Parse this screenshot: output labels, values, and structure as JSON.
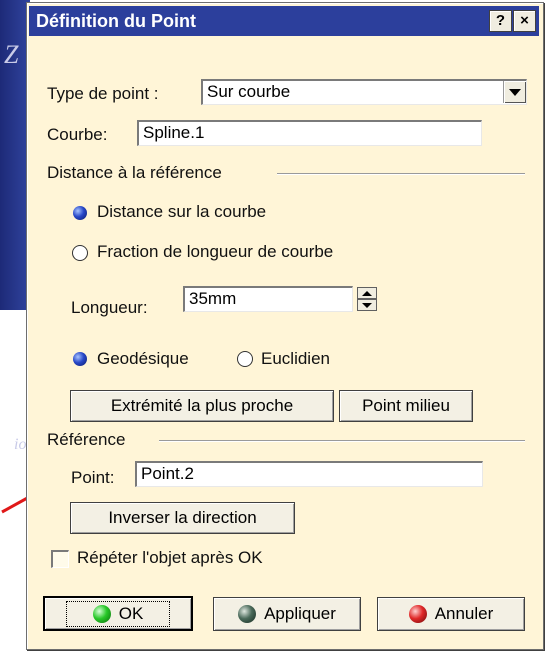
{
  "background": {
    "letter": "Z",
    "word_fragment": "io"
  },
  "dialog": {
    "title": "Définition du Point",
    "help_label": "?",
    "close_label": "×",
    "point_type": {
      "label": "Type de point :",
      "value": "Sur courbe"
    },
    "curve": {
      "label": "Courbe:",
      "value": "Spline.1"
    },
    "distance_group": {
      "label": "Distance à la référence",
      "option_distance": "Distance sur la courbe",
      "option_fraction": "Fraction de longueur de courbe",
      "length_label": "Longueur:",
      "length_value": "35mm",
      "geodesic": "Geodésique",
      "euclidean": "Euclidien",
      "nearest_end_button": "Extrémité la plus proche",
      "midpoint_button": "Point milieu"
    },
    "reference_group": {
      "label": "Référence",
      "point_label": "Point:",
      "point_value": "Point.2",
      "invert_button": "Inverser la direction"
    },
    "repeat_checkbox": "Répéter l'objet après OK",
    "buttons": {
      "ok": "OK",
      "apply": "Appliquer",
      "cancel": "Annuler"
    }
  },
  "colors": {
    "titlebar": "#2c3f9c",
    "dialog_bg": "#fff5d7",
    "arrow": "#e01818"
  }
}
